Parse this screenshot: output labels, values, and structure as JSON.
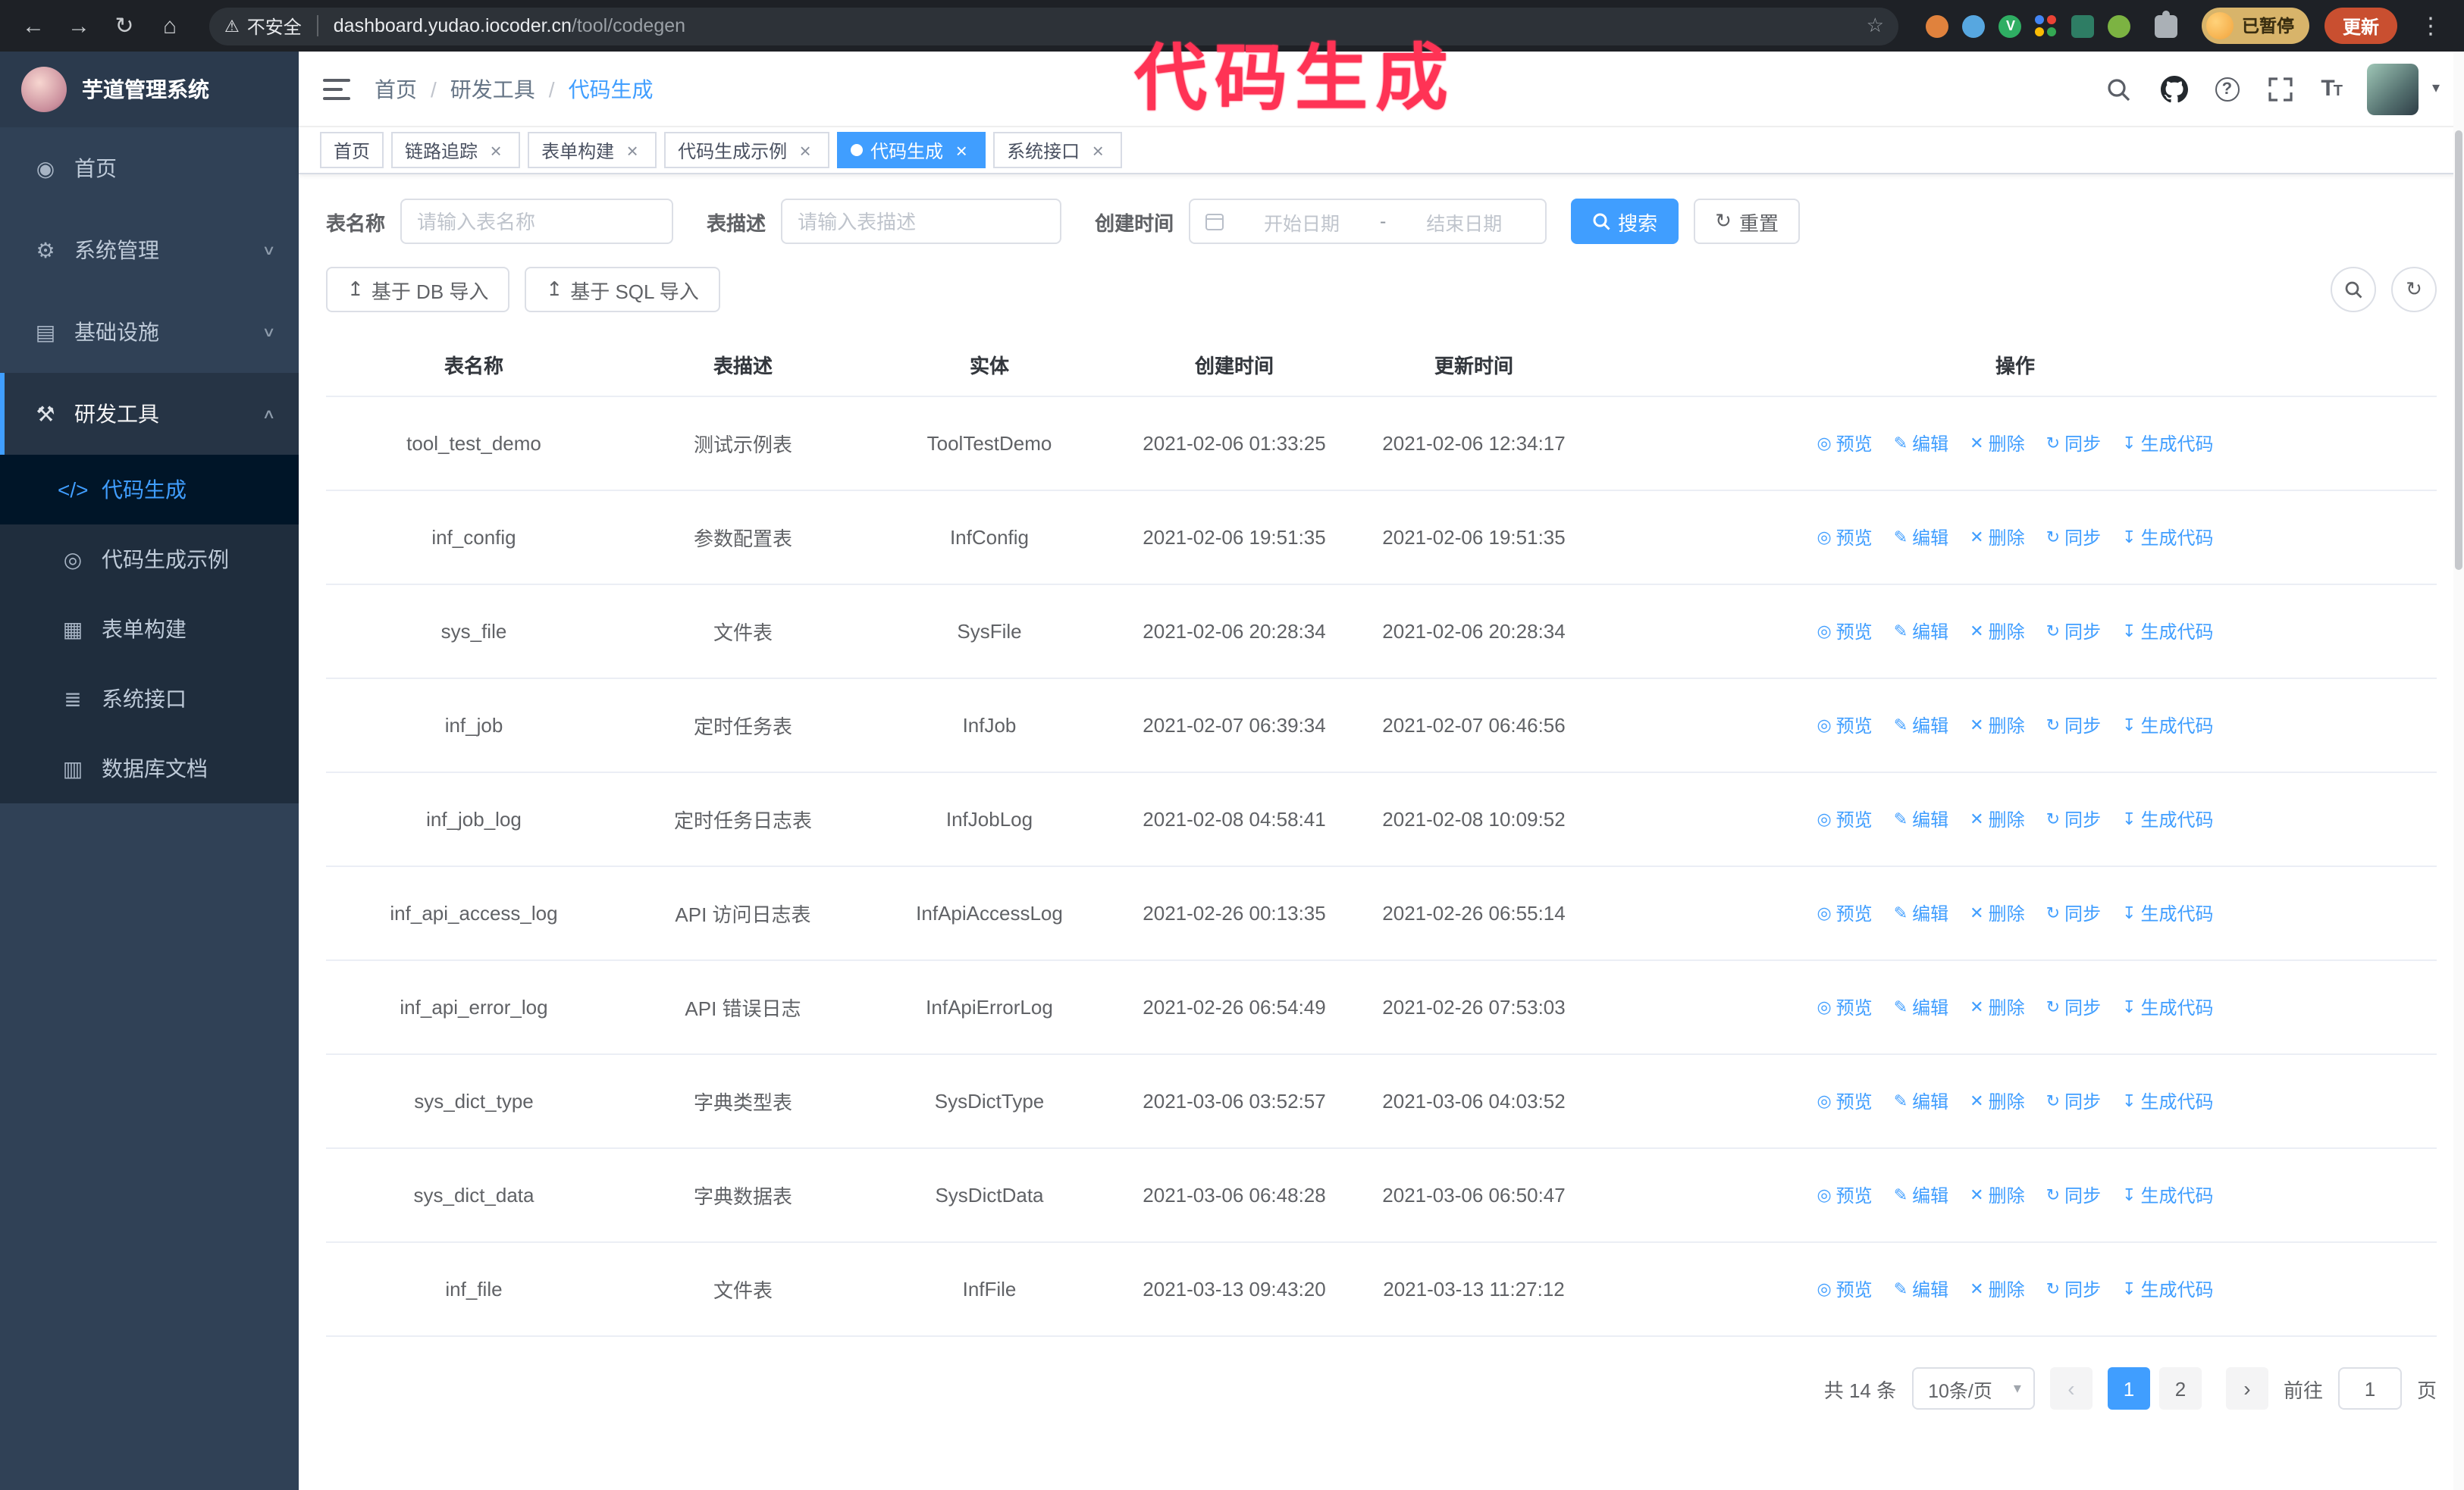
{
  "annotation": {
    "text": "代码生成"
  },
  "browser": {
    "security_warning": "不安全",
    "url_host": "dashboard.yudao.iocoder.cn",
    "url_path": "/tool/codegen",
    "paused_badge": "已暂停",
    "update_button": "更新",
    "extensions": [
      {
        "name": "extension-icon-1",
        "shape": "circle",
        "color": "#e0823d",
        "glyph": ""
      },
      {
        "name": "extension-icon-2",
        "shape": "circle",
        "color": "#57a7e0",
        "glyph": ""
      },
      {
        "name": "extension-icon-3",
        "shape": "circle",
        "color": "#2fae63",
        "glyph": "V"
      },
      {
        "name": "extension-icon-4",
        "shape": "grid"
      },
      {
        "name": "extension-icon-5",
        "shape": "square",
        "color": "#2e7d64",
        "glyph": ""
      },
      {
        "name": "extension-icon-6",
        "shape": "circle",
        "color": "#7cb342",
        "glyph": ""
      }
    ]
  },
  "sidebar": {
    "logo_title": "芋道管理系统",
    "items": [
      {
        "id": "home",
        "label": "首页",
        "glyph": "◉",
        "chevron": null
      },
      {
        "id": "system",
        "label": "系统管理",
        "glyph": "⚙",
        "chevron": "down"
      },
      {
        "id": "infra",
        "label": "基础设施",
        "glyph": "▤",
        "chevron": "down"
      },
      {
        "id": "devtools",
        "label": "研发工具",
        "glyph": "⚒",
        "chevron": "up",
        "expanded": true,
        "children": [
          {
            "id": "codegen",
            "label": "代码生成",
            "glyph": "</>",
            "active": true
          },
          {
            "id": "codegen-example",
            "label": "代码生成示例",
            "glyph": "◎"
          },
          {
            "id": "form-builder",
            "label": "表单构建",
            "glyph": "▦"
          },
          {
            "id": "system-api",
            "label": "系统接口",
            "glyph": "≣"
          },
          {
            "id": "db-doc",
            "label": "数据库文档",
            "glyph": "▥"
          }
        ]
      }
    ]
  },
  "header": {
    "breadcrumb": [
      "首页",
      "研发工具",
      "代码生成"
    ]
  },
  "tabs": [
    {
      "label": "首页",
      "closable": false,
      "active": false
    },
    {
      "label": "链路追踪",
      "closable": true,
      "active": false
    },
    {
      "label": "表单构建",
      "closable": true,
      "active": false
    },
    {
      "label": "代码生成示例",
      "closable": true,
      "active": false
    },
    {
      "label": "代码生成",
      "closable": true,
      "active": true
    },
    {
      "label": "系统接口",
      "closable": true,
      "active": false
    }
  ],
  "filters": {
    "table_name_label": "表名称",
    "table_name_placeholder": "请输入表名称",
    "table_desc_label": "表描述",
    "table_desc_placeholder": "请输入表描述",
    "create_time_label": "创建时间",
    "date_start_placeholder": "开始日期",
    "date_separator": "-",
    "date_end_placeholder": "结束日期",
    "search_button": "搜索",
    "reset_button": "重置"
  },
  "toolbar": {
    "import_db": "基于 DB 导入",
    "import_sql": "基于 SQL 导入"
  },
  "table": {
    "columns": [
      "表名称",
      "表描述",
      "实体",
      "创建时间",
      "更新时间",
      "操作"
    ],
    "actions": [
      {
        "id": "preview",
        "label": "预览",
        "glyph": "◎",
        "icon_name": "eye-icon"
      },
      {
        "id": "edit",
        "label": "编辑",
        "glyph": "✎",
        "icon_name": "edit-icon"
      },
      {
        "id": "delete",
        "label": "删除",
        "glyph": "✕",
        "icon_name": "trash-icon"
      },
      {
        "id": "sync",
        "label": "同步",
        "glyph": "↻",
        "icon_name": "sync-icon"
      },
      {
        "id": "generate",
        "label": "生成代码",
        "glyph": "↧",
        "icon_name": "download-icon"
      }
    ],
    "rows": [
      {
        "name": "tool_test_demo",
        "desc": "测试示例表",
        "entity": "ToolTestDemo",
        "created": "2021-02-06 01:33:25",
        "updated": "2021-02-06 12:34:17"
      },
      {
        "name": "inf_config",
        "desc": "参数配置表",
        "entity": "InfConfig",
        "created": "2021-02-06 19:51:35",
        "updated": "2021-02-06 19:51:35"
      },
      {
        "name": "sys_file",
        "desc": "文件表",
        "entity": "SysFile",
        "created": "2021-02-06 20:28:34",
        "updated": "2021-02-06 20:28:34"
      },
      {
        "name": "inf_job",
        "desc": "定时任务表",
        "entity": "InfJob",
        "created": "2021-02-07 06:39:34",
        "updated": "2021-02-07 06:46:56"
      },
      {
        "name": "inf_job_log",
        "desc": "定时任务日志表",
        "entity": "InfJobLog",
        "created": "2021-02-08 04:58:41",
        "updated": "2021-02-08 10:09:52"
      },
      {
        "name": "inf_api_access_log",
        "desc": "API 访问日志表",
        "entity": "InfApiAccessLog",
        "created": "2021-02-26 00:13:35",
        "updated": "2021-02-26 06:55:14"
      },
      {
        "name": "inf_api_error_log",
        "desc": "API 错误日志",
        "entity": "InfApiErrorLog",
        "created": "2021-02-26 06:54:49",
        "updated": "2021-02-26 07:53:03"
      },
      {
        "name": "sys_dict_type",
        "desc": "字典类型表",
        "entity": "SysDictType",
        "created": "2021-03-06 03:52:57",
        "updated": "2021-03-06 04:03:52"
      },
      {
        "name": "sys_dict_data",
        "desc": "字典数据表",
        "entity": "SysDictData",
        "created": "2021-03-06 06:48:28",
        "updated": "2021-03-06 06:50:47"
      },
      {
        "name": "inf_file",
        "desc": "文件表",
        "entity": "InfFile",
        "created": "2021-03-13 09:43:20",
        "updated": "2021-03-13 11:27:12"
      }
    ]
  },
  "pagination": {
    "total": "共 14 条",
    "page_size": "10条/页",
    "pages": [
      {
        "label": "1",
        "active": true
      },
      {
        "label": "2",
        "active": false
      }
    ],
    "prev": "‹",
    "next": "›",
    "goto_label": "前往",
    "goto_value": "1",
    "goto_suffix": "页"
  },
  "colors": {
    "accent": "#409eff",
    "annotation": "#ff3355",
    "sidebar_bg": "#304156",
    "submenu_bg": "#1f2d3d"
  }
}
